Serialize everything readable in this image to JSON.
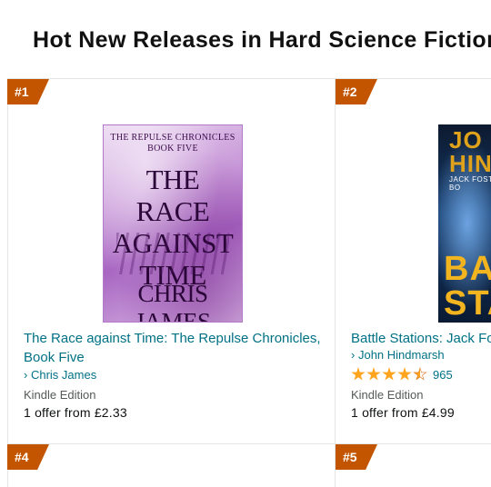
{
  "page": {
    "heading": "Hot New Releases in Hard Science Fiction"
  },
  "items": [
    {
      "rank": "#1",
      "cover": {
        "series": "THE REPULSE CHRONICLES",
        "book": "BOOK FIVE",
        "title": "THE RACE AGAINST TIME",
        "author": "CHRIS JAMES"
      },
      "title": "The Race against Time: The Repulse Chronicles, Book Five",
      "author": "Chris James",
      "format": "Kindle Edition",
      "offer": "1 offer from £2.33"
    },
    {
      "rank": "#2",
      "cover": {
        "author": "JO HINDM",
        "subtitle": "JACK FOSTER BO",
        "title": "BA STAT"
      },
      "title": "Battle Stations: Jack Fo",
      "author": "John Hindmarsh",
      "rating": 4.5,
      "review_count": "965",
      "format": "Kindle Edition",
      "offer": "1 offer from £4.99"
    },
    {
      "rank": "#4"
    },
    {
      "rank": "#5"
    }
  ],
  "icons": {
    "author_prefix": "›",
    "star": "star-icon"
  },
  "colors": {
    "link": "#007185",
    "rank_badge": "#c45500",
    "star": "#ffa41c"
  }
}
